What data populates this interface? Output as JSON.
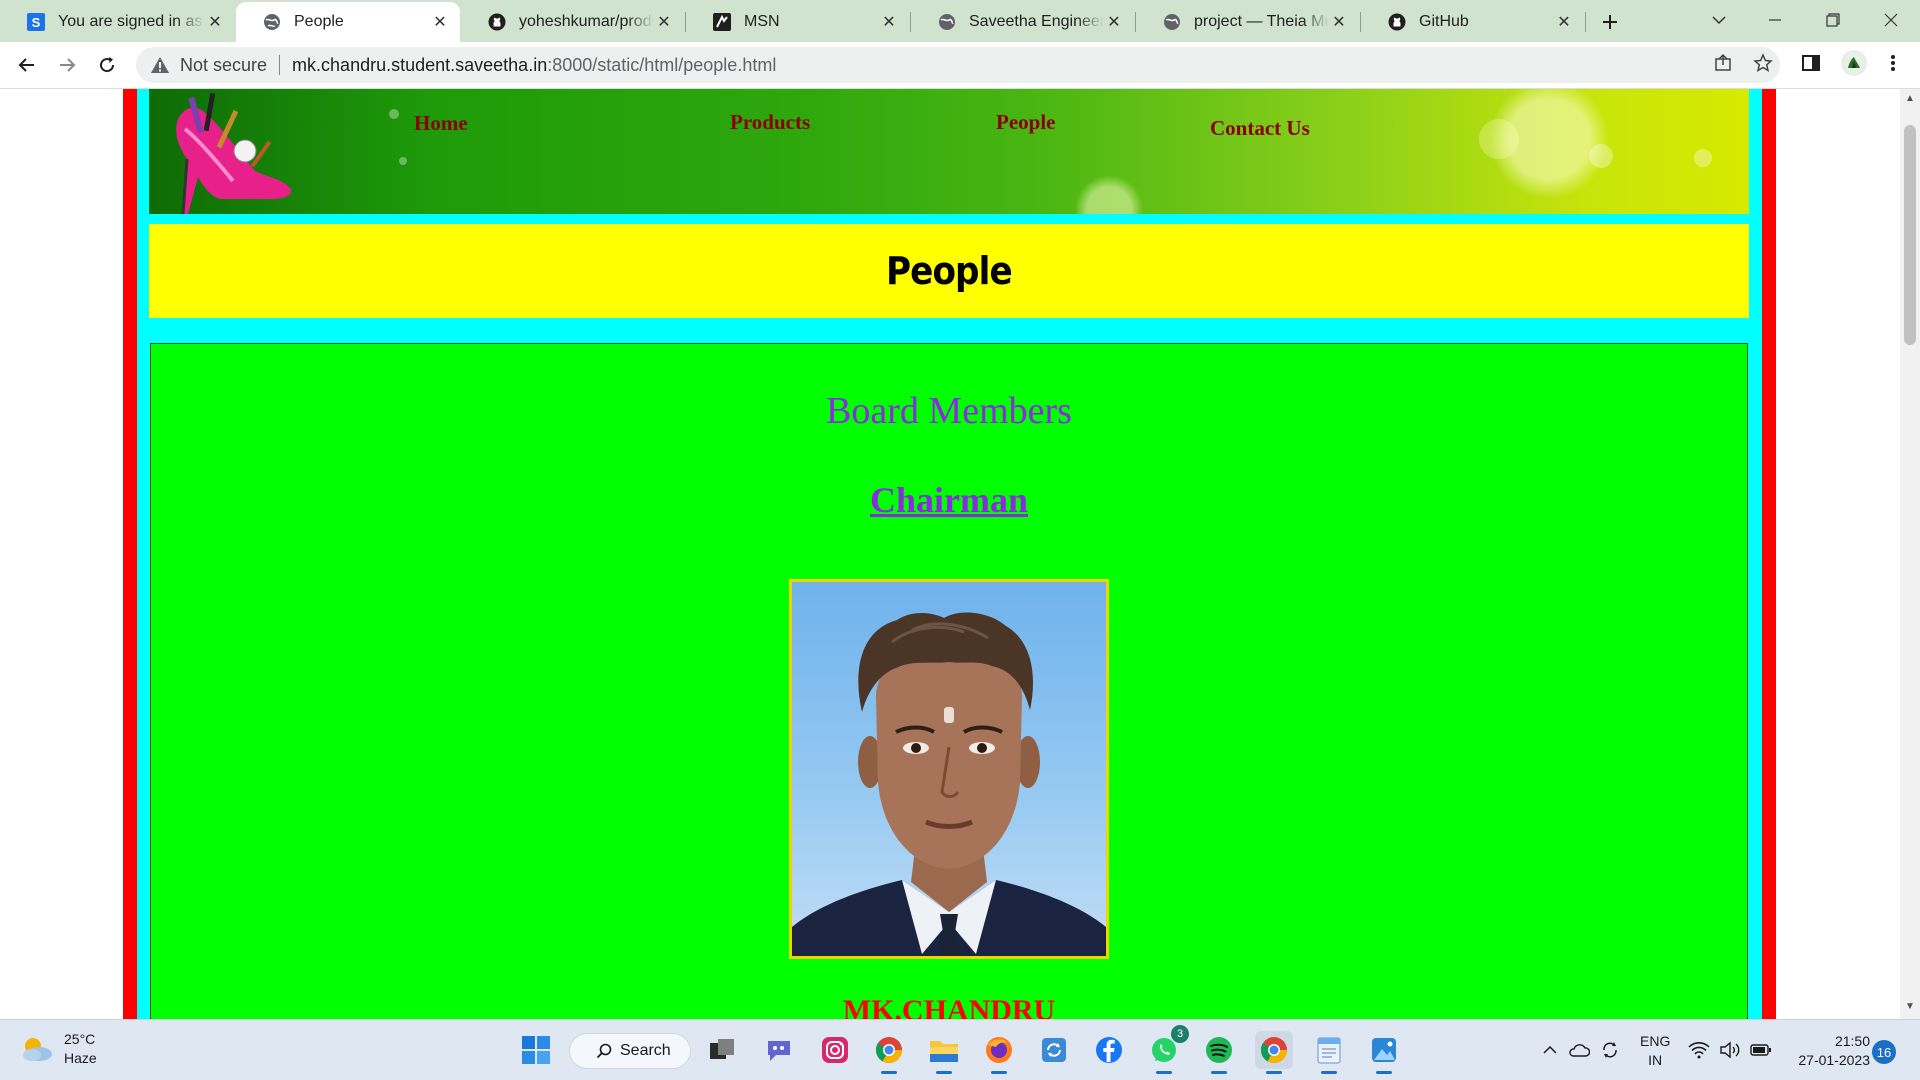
{
  "browser": {
    "tabs": [
      {
        "title": "You are signed in as e",
        "icon": "s-logo-icon",
        "active": false
      },
      {
        "title": "People",
        "icon": "globe-icon",
        "active": true
      },
      {
        "title": "yoheshkumar/product",
        "icon": "github-icon",
        "active": false
      },
      {
        "title": "MSN",
        "icon": "msn-icon",
        "active": false
      },
      {
        "title": "Saveetha Engineering",
        "icon": "globe-icon",
        "active": false
      },
      {
        "title": "project — Theia Multi",
        "icon": "globe-icon",
        "active": false
      },
      {
        "title": "GitHub",
        "icon": "github-icon",
        "active": false
      }
    ],
    "security_label": "Not secure",
    "url_host": "mk.chandru.student.saveetha.in",
    "url_path": ":8000/static/html/people.html"
  },
  "page": {
    "nav": {
      "home": "Home",
      "products": "Products",
      "people": "People",
      "contact": "Contact Us"
    },
    "title": "People",
    "section_heading": "Board Members",
    "role_link": "Chairman",
    "person_name": "MK.CHANDRU",
    "colors": {
      "outer_border": "#ff0000",
      "frame": "#00ffff",
      "title_bg": "#ffff00",
      "content_bg": "#00ff00",
      "nav_text": "#8b0000",
      "heading_text": "#8a2be2",
      "name_text": "#ff0000"
    }
  },
  "taskbar": {
    "weather_temp": "25°C",
    "weather_desc": "Haze",
    "search_label": "Search",
    "whatsapp_badge": "3",
    "lang_line1": "ENG",
    "lang_line2": "IN",
    "time": "21:50",
    "date": "27-01-2023",
    "notification_count": "16"
  }
}
